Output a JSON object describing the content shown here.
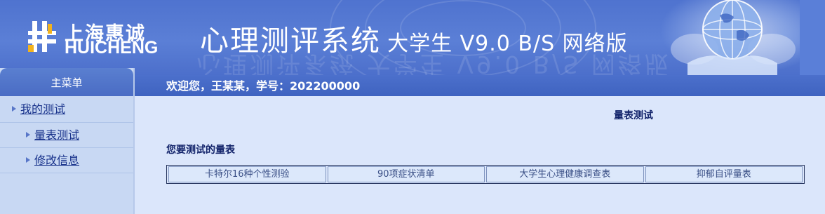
{
  "header": {
    "logo_cn": "上海惠诚",
    "logo_en": "HUICHENG",
    "title_main": "心理测评系统",
    "title_sub": "大学生 V9.0 B/S 网络版",
    "title_reflection": "心理测评系统 大学生 V9.0 B/S 网络版"
  },
  "sidebar": {
    "title": "主菜单",
    "items": [
      {
        "label": "我的测试",
        "level": 0
      },
      {
        "label": "量表测试",
        "level": 1
      },
      {
        "label": "修改信息",
        "level": 1
      }
    ]
  },
  "welcome": {
    "text": "欢迎您，王某某，学号：202200000"
  },
  "main": {
    "section_title": "量表测试",
    "scales_heading": "您要测试的量表",
    "scales": [
      "卡特尔16种个性测验",
      "90项症状清单",
      "大学生心理健康调查表",
      "抑郁自评量表"
    ]
  },
  "colors": {
    "banner": "#5b7fd6",
    "welcome_bar": "#4468c4",
    "content_bg": "#dbe6fb",
    "sidebar_bg": "#c8d8f3",
    "menu_link": "#16308a",
    "heading_text": "#12236a"
  }
}
